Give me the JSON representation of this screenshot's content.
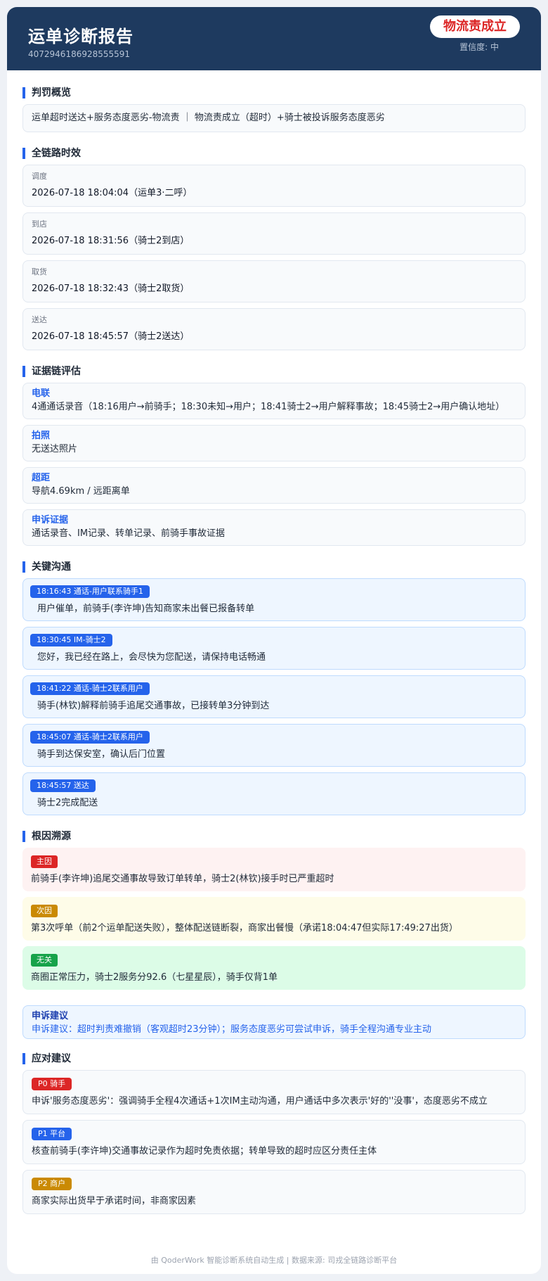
{
  "header": {
    "title": "运单诊断报告",
    "order_id": "4072946186928555591",
    "verdict": "物流责成立",
    "confidence": "置信度: 中"
  },
  "penalty": {
    "section_title": "判罚概览",
    "summary": "运单超时送达+服务态度恶劣-物流责 ｜ 物流责成立（超时）+骑士被投诉服务态度恶劣"
  },
  "timeline": {
    "section_title": "全链路时效",
    "items": [
      {
        "label": "调度",
        "value": "2026-07-18 18:04:04（运单3·二呼）"
      },
      {
        "label": "到店",
        "value": "2026-07-18 18:31:56（骑士2到店）"
      },
      {
        "label": "取货",
        "value": "2026-07-18 18:32:43（骑士2取货）"
      },
      {
        "label": "送达",
        "value": "2026-07-18 18:45:57（骑士2送达）"
      }
    ]
  },
  "evidence": {
    "section_title": "证据链评估",
    "items": [
      {
        "title": "电联",
        "text": "4通通话录音（18:16用户→前骑手；18:30未知→用户；18:41骑士2→用户解释事故；18:45骑士2→用户确认地址）"
      },
      {
        "title": "拍照",
        "text": "无送达照片"
      },
      {
        "title": "超距",
        "text": "导航4.69km / 远距离单"
      },
      {
        "title": "申诉证据",
        "text": "通话录音、IM记录、转单记录、前骑手事故证据"
      }
    ]
  },
  "communication": {
    "section_title": "关键沟通",
    "items": [
      {
        "tag": "18:16:43  通话-用户联系骑手1",
        "text": "用户催单，前骑手(李许坤)告知商家未出餐已报备转单"
      },
      {
        "tag": "18:30:45  IM-骑士2",
        "text": "您好，我已经在路上，会尽快为您配送，请保持电话畅通"
      },
      {
        "tag": "18:41:22  通话-骑士2联系用户",
        "text": "骑手(林钦)解释前骑手追尾交通事故，已接转单3分钟到达"
      },
      {
        "tag": "18:45:07  通话-骑士2联系用户",
        "text": "骑手到达保安室，确认后门位置"
      },
      {
        "tag": "18:45:57  送达",
        "text": "骑士2完成配送"
      }
    ]
  },
  "root_cause": {
    "section_title": "根因溯源",
    "items": [
      {
        "tag": "主因",
        "text": "前骑手(李许坤)追尾交通事故导致订单转单，骑士2(林钦)接手时已严重超时",
        "tag_color": "#dc2626",
        "bg_color": "#fef2f2"
      },
      {
        "tag": "次因",
        "text": "第3次呼单（前2个运单配送失败），整体配送链断裂，商家出餐慢（承诺18:04:47但实际17:49:27出货）",
        "tag_color": "#ca8a04",
        "bg_color": "#fefce8"
      },
      {
        "tag": "无关",
        "text": "商圈正常压力，骑士2服务分92.6（七星星辰），骑手仅背1单",
        "tag_color": "#16a34a",
        "bg_color": "#dcfce7"
      }
    ]
  },
  "appeal": {
    "title": "申诉建议",
    "text": "申诉建议：超时判责难撤销（客观超时23分钟）；服务态度恶劣可尝试申诉，骑手全程沟通专业主动"
  },
  "suggestions": {
    "section_title": "应对建议",
    "items": [
      {
        "tag": "P0 骑手",
        "text": "申诉'服务态度恶劣'：强调骑手全程4次通话+1次IM主动沟通，用户通话中多次表示'好的''没事'，态度恶劣不成立",
        "tag_color": "#dc2626"
      },
      {
        "tag": "P1 平台",
        "text": "核查前骑手(李许坤)交通事故记录作为超时免责依据；转单导致的超时应区分责任主体",
        "tag_color": "#2563eb"
      },
      {
        "tag": "P2 商户",
        "text": "商家实际出货早于承诺时间，非商家因素",
        "tag_color": "#ca8a04"
      }
    ]
  },
  "footer": {
    "text": "由 QoderWork 智能诊断系统自动生成 | 数据来源: 司戎全链路诊断平台"
  }
}
